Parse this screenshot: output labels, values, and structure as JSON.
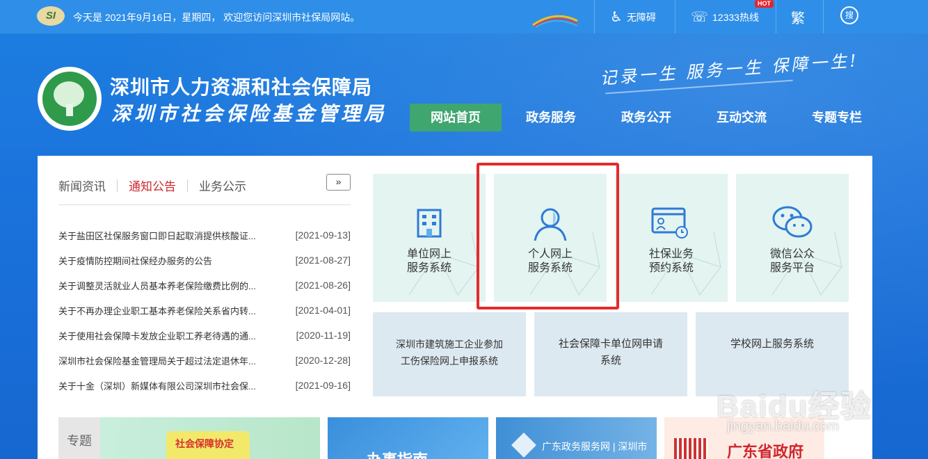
{
  "topbar": {
    "logo_text": "SI",
    "today": "今天是 2021年9月16日，星期四， 欢迎您访问深圳市社保局网站。",
    "accessibility": "无障碍",
    "hotline": "12333热线",
    "hot_badge": "HOT",
    "traditional": "繁",
    "search": "搜"
  },
  "header": {
    "title1": "深圳市人力资源和社会保障局",
    "title2": "深圳市社会保险基金管理局",
    "slogan": "记录一生 服务一生 保障一生!"
  },
  "nav": [
    "网站首页",
    "政务服务",
    "政务公开",
    "互动交流",
    "专题专栏"
  ],
  "news": {
    "tabs": [
      "新闻资讯",
      "通知公告",
      "业务公示"
    ],
    "active_tab": "通知公告",
    "more": "»",
    "items": [
      {
        "title": "关于盐田区社保服务窗口即日起取消提供核酸证...",
        "date": "[2021-09-13]"
      },
      {
        "title": "关于疫情防控期间社保经办服务的公告",
        "date": "[2021-08-27]"
      },
      {
        "title": "关于调整灵活就业人员基本养老保险缴费比例的...",
        "date": "[2021-08-26]"
      },
      {
        "title": "关于不再办理企业职工基本养老保险关系省内转...",
        "date": "[2021-04-01]"
      },
      {
        "title": "关于使用社会保障卡发放企业职工养老待遇的通...",
        "date": "[2020-11-19]"
      },
      {
        "title": "深圳市社会保险基金管理局关于超过法定退休年...",
        "date": "[2020-12-28]"
      },
      {
        "title": "关于十金（深圳）新媒体有限公司深圳市社会保...",
        "date": "[2021-09-16]"
      }
    ]
  },
  "services": [
    {
      "line1": "单位网上",
      "line2": "服务系统",
      "icon": "building-icon"
    },
    {
      "line1": "个人网上",
      "line2": "服务系统",
      "icon": "person-icon"
    },
    {
      "line1": "社保业务",
      "line2": "预约系统",
      "icon": "appointment-icon"
    },
    {
      "line1": "微信公众",
      "line2": "服务平台",
      "icon": "wechat-icon"
    }
  ],
  "wide_services": [
    {
      "line1": "深圳市建筑施工企业参加",
      "line2": "工伤保险网上申报系统"
    },
    {
      "line1": "社会保障卡单位网申请",
      "line2": "系统"
    },
    {
      "line1": "学校网上服务系统",
      "line2": ""
    }
  ],
  "banners": {
    "special_label": "专题",
    "b1": "社会保障协定",
    "b2": "办事指南",
    "b3": "广东政务服务网 | 深圳市",
    "b4": "广东省政府"
  },
  "watermark": {
    "main": "Baidu经验",
    "sub": "jingyan.baidu.com"
  },
  "colors": {
    "nav_active": "#3fa66f",
    "highlight_box": "#e52a2a",
    "active_tab": "#d0282e"
  }
}
